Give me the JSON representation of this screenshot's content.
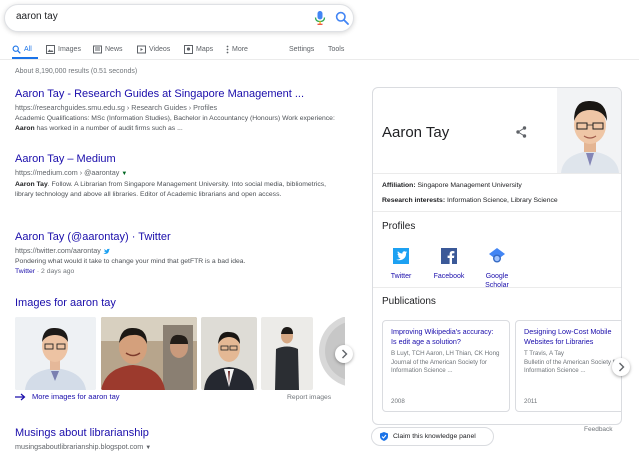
{
  "search": {
    "query": "aaron tay"
  },
  "tabs": [
    {
      "label": "All",
      "icon": "search-icon",
      "active": true
    },
    {
      "label": "Images",
      "icon": "image-icon"
    },
    {
      "label": "News",
      "icon": "news-icon"
    },
    {
      "label": "Videos",
      "icon": "video-icon"
    },
    {
      "label": "Maps",
      "icon": "map-icon"
    },
    {
      "label": "More",
      "icon": "more-icon"
    }
  ],
  "tools": {
    "settings": "Settings",
    "tools": "Tools"
  },
  "stats": "About 8,190,000 results (0.51 seconds)",
  "results": [
    {
      "title": "Aaron Tay - Research Guides at Singapore Management ...",
      "url": "https://researchguides.smu.edu.sg › Research Guides › Profiles",
      "snippet_pre": "Academic Qualifications: MSc (Information Studies), Bachelor in Accountancy (Honours) Work experience: ",
      "snippet_bold": "Aaron",
      "snippet_post": " has worked in a number of audit firms such as ..."
    },
    {
      "title": "Aaron Tay – Medium",
      "url": "https://medium.com › @aarontay",
      "snippet_bold": "Aaron Tay",
      "snippet_post": ". Follow. A Librarian from Singapore Management University. Into social media, bibliometrics, library technology and above all libraries. Editor of Academic librarians and open access."
    },
    {
      "title": "Aaron Tay (@aarontay) · Twitter",
      "url": "https://twitter.com/aarontay",
      "snippet": "Pondering what would it take to change your mind that getFTR is a bad idea.",
      "foot_link": "Twitter",
      "foot_rest": " · 2 days ago"
    }
  ],
  "images": {
    "heading": "Images for aaron tay",
    "more": "More images for aaron tay",
    "report": "Report images"
  },
  "last_result": {
    "title": "Musings about librarianship",
    "url": "musingsaboutlibrarianship.blogspot.com"
  },
  "knowledge_panel": {
    "name": "Aaron Tay",
    "affiliation_label": "Affiliation:",
    "affiliation": "Singapore Management University",
    "interests_label": "Research interests:",
    "interests": "Information Science, Library Science",
    "profiles_heading": "Profiles",
    "profiles": [
      {
        "label": "Twitter",
        "icon": "twitter-icon"
      },
      {
        "label": "Facebook",
        "icon": "facebook-icon"
      },
      {
        "label": "Google Scholar",
        "label1": "Google",
        "label2": "Scholar",
        "icon": "google-scholar-icon"
      }
    ],
    "publications_heading": "Publications",
    "publications": [
      {
        "title": "Improving Wikipedia's accuracy: Is edit age a solution?",
        "authors": "B Luyt, TCH Aaron, LH Thian, CK Hong",
        "venue": "Journal of the American Society for Information Science ...",
        "year": "2008"
      },
      {
        "title": "Designing Low-Cost Mobile Websites for Libraries",
        "authors": "T Travis, A Tay",
        "venue": "Bulletin of the American Society for Information Science ...",
        "year": "2011"
      }
    ],
    "feedback": "Feedback",
    "claim": "Claim this knowledge panel"
  },
  "colors": {
    "link": "#1a0dab",
    "url_green": "#006621",
    "accent": "#1a73e8"
  }
}
